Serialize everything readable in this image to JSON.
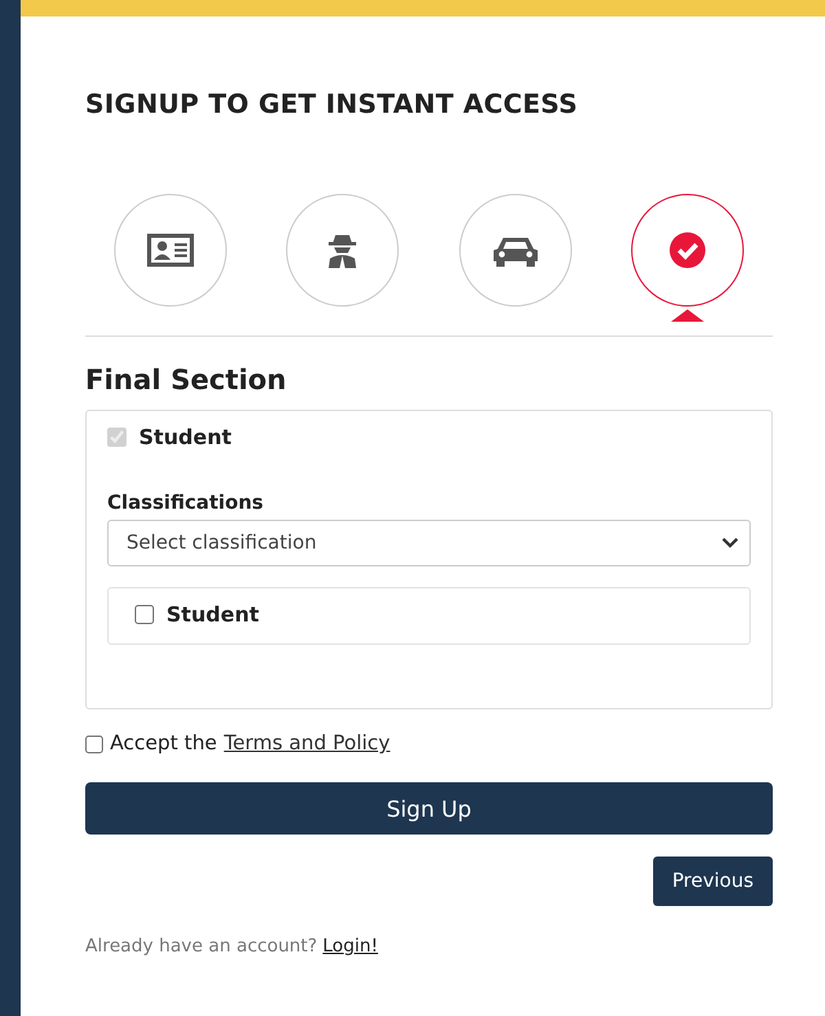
{
  "heading": "SIGNUP TO GET INSTANT ACCESS",
  "steps": [
    {
      "kind": "id-card",
      "selected": false
    },
    {
      "kind": "spy",
      "selected": false
    },
    {
      "kind": "car",
      "selected": false
    },
    {
      "kind": "check",
      "selected": true
    }
  ],
  "section_title": "Final Section",
  "section": {
    "main_option": {
      "label": "Student",
      "checked": true,
      "disabled": true
    },
    "classifications": {
      "label": "Classifications",
      "placeholder": "Select classification"
    },
    "sub_option": {
      "label": "Student",
      "checked": false
    }
  },
  "terms": {
    "prefix": "Accept the",
    "link": "Terms and Policy",
    "checked": false
  },
  "buttons": {
    "submit": "Sign Up",
    "previous": "Previous"
  },
  "footer": {
    "text": "Already have an account?",
    "link": "Login!"
  }
}
